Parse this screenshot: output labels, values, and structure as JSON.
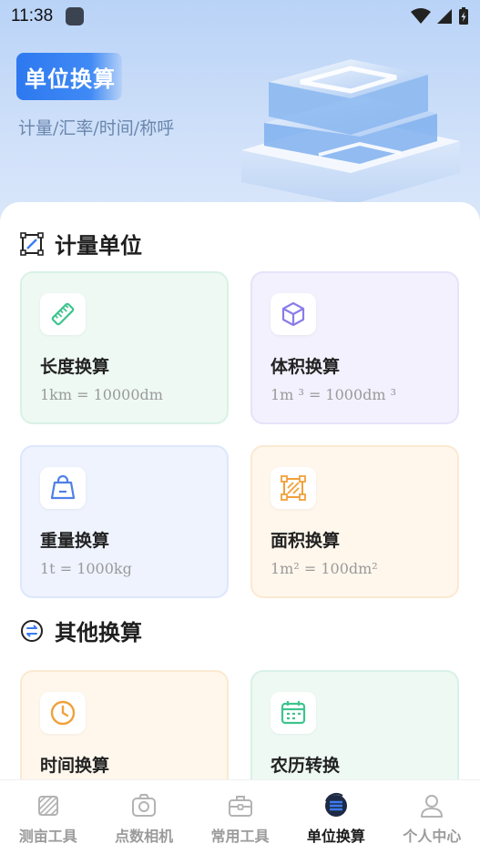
{
  "status_bar": {
    "time": "11:38"
  },
  "hero": {
    "badge": "单位换算",
    "subtitle": "计量/汇率/时间/称呼"
  },
  "sections": {
    "measure": {
      "title": "计量单位",
      "cards": [
        {
          "title": "长度换算",
          "sub": "1km = 10000dm",
          "icon": "ruler-icon",
          "color": "#3ec48e"
        },
        {
          "title": "体积换算",
          "sub": "1m ³ = 1000dm ³",
          "icon": "cube-icon",
          "color": "#8a7de8"
        },
        {
          "title": "重量换算",
          "sub": "1t = 1000kg",
          "icon": "weight-icon",
          "color": "#4f7fe8"
        },
        {
          "title": "面积换算",
          "sub": "1m² = 100dm²",
          "icon": "area-icon",
          "color": "#f0a13b"
        }
      ]
    },
    "other": {
      "title": "其他换算",
      "cards": [
        {
          "title": "时间换算",
          "icon": "clock-icon",
          "color": "#f0a13b"
        },
        {
          "title": "农历转换",
          "icon": "calendar-icon",
          "color": "#3ec48e"
        }
      ]
    }
  },
  "tabbar": {
    "items": [
      {
        "label": "测亩工具",
        "icon": "field-icon",
        "active": false
      },
      {
        "label": "点数相机",
        "icon": "camera-icon",
        "active": false
      },
      {
        "label": "常用工具",
        "icon": "toolbox-icon",
        "active": false
      },
      {
        "label": "单位换算",
        "icon": "convert-icon",
        "active": true
      },
      {
        "label": "个人中心",
        "icon": "user-icon",
        "active": false
      }
    ]
  },
  "colors": {
    "accent": "#2e78f0",
    "hero_bg": "#c6dbf8",
    "inactive_tab": "#9b9b9b"
  }
}
